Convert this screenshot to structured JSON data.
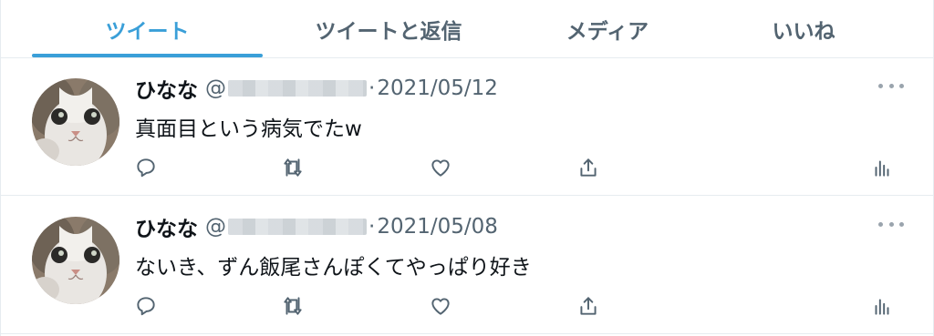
{
  "tabs": [
    {
      "label": "ツイート",
      "active": true
    },
    {
      "label": "ツイートと返信",
      "active": false
    },
    {
      "label": "メディア",
      "active": false
    },
    {
      "label": "いいね",
      "active": false
    }
  ],
  "colors": {
    "accent": "#3a9fd8",
    "secondary_text": "#536471",
    "divider": "#e6ecf0"
  },
  "tweets": [
    {
      "name": "ひなな",
      "handle_prefix": "@",
      "separator": "·",
      "date": "2021/05/12",
      "text": "真面目という病気でたw"
    },
    {
      "name": "ひなな",
      "handle_prefix": "@",
      "separator": "·",
      "date": "2021/05/08",
      "text": "ないき、ずん飯尾さんぽくてやっぱり好き"
    }
  ],
  "icons": [
    "reply-icon",
    "retweet-icon",
    "like-icon",
    "share-icon",
    "analytics-icon",
    "more-icon"
  ]
}
